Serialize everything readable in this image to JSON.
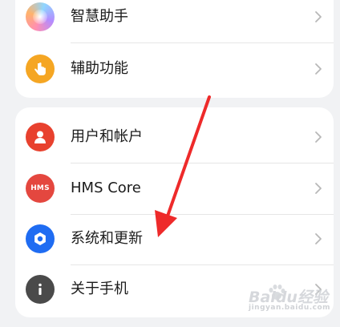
{
  "settings": {
    "group1": [
      {
        "label": "智慧助手",
        "icon": "smart-assistant-icon"
      },
      {
        "label": "辅助功能",
        "icon": "accessibility-hand-icon"
      }
    ],
    "group2": [
      {
        "label": "用户和帐户",
        "icon": "user-icon"
      },
      {
        "label": "HMS Core",
        "icon": "hms-icon",
        "icon_text": "HMS"
      },
      {
        "label": "系统和更新",
        "icon": "gear-icon"
      },
      {
        "label": "关于手机",
        "icon": "info-icon"
      }
    ]
  },
  "colors": {
    "accessibility": "#f5a623",
    "user": "#e8412e",
    "hms": "#e4473f",
    "system": "#1f6cf2",
    "about": "#4a4a4a",
    "annotation_arrow": "#ee2a2a"
  },
  "watermark": {
    "text": "Baidu经验",
    "sub": "jingyan.baidu.com"
  }
}
